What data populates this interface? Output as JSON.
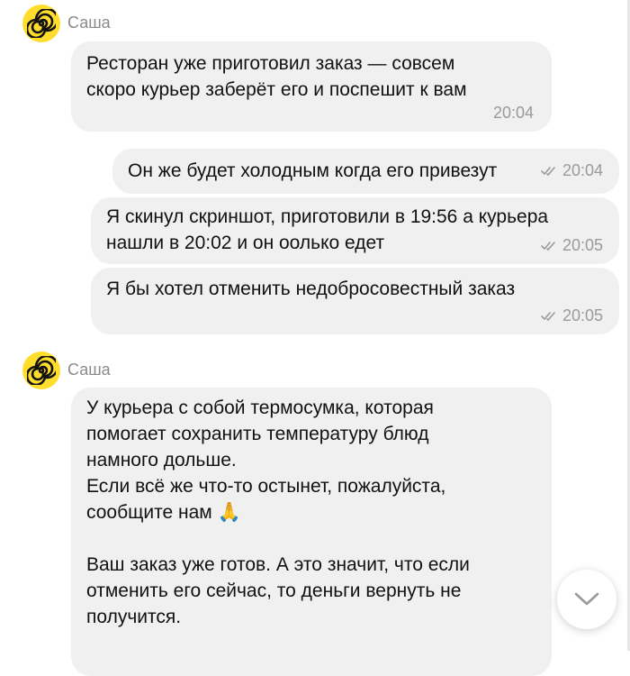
{
  "chat": {
    "messages": [
      {
        "sender": "Саша",
        "text": "Ресторан уже приготовил заказ — совсем\nскоро курьер заберёт его и поспешит к вам",
        "time": "20:04"
      },
      {
        "text": "Он же будет холодным когда его привезут",
        "time": "20:04"
      },
      {
        "text": "Я скинул скриншот, приготовили в 19:56 а курьера\nнашли в 20:02 и он оолько едет",
        "time": "20:05"
      },
      {
        "text": "Я бы хотел отменить недобросовестный заказ",
        "time": "20:05"
      },
      {
        "sender": "Саша",
        "text": "У курьера с собой термосумка, которая\nпомогает сохранить температуру блюд\nнамного дольше.\nЕсли всё же что-то остынет, пожалуйста,\nсообщите нам 🙏\n\nВаш заказ уже готов. А это значит, что если\nотменить его сейчас, то деньги вернуть не\nполучится."
      }
    ]
  },
  "icons": {
    "avatar": "spiral-logo-icon",
    "read_receipt": "double-check-icon",
    "scroll_down": "chevron-down-icon"
  },
  "colors": {
    "avatar_bg": "#ffdd2d",
    "bubble_bg": "#f0f0f0",
    "muted_text": "#9a9a9a"
  }
}
